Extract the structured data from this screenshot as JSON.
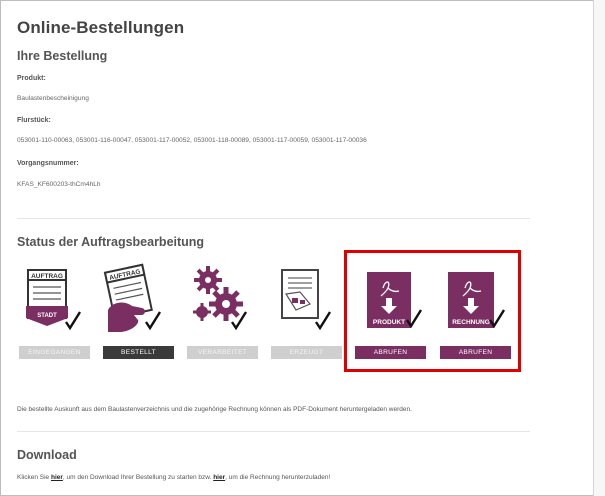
{
  "page": {
    "title": "Online-Bestellungen"
  },
  "order": {
    "heading": "Ihre Bestellung",
    "product_label": "Produkt:",
    "product_value": "Baulastenbescheinigung",
    "parcel_label": "Flurstück:",
    "parcel_value": "053001-110-00063, 053001-116-00047, 053001-117-00052, 053001-118-00089, 053001-117-00059, 053001-117-00036",
    "process_label": "Vorgangsnummer:",
    "process_value": "KFAS_KF600203-thCm4hLh"
  },
  "status": {
    "heading": "Status der Auftragsbearbeitung",
    "steps": [
      {
        "art_top": "AUFTRAG",
        "art_bottom": "STADT",
        "button": "EINGEGANGEN"
      },
      {
        "art_top": "AUFTRAG",
        "button": "BESTELLT"
      },
      {
        "button": "VERARBEITET"
      },
      {
        "button": "ERZEUGT"
      },
      {
        "art_bottom": "PRODUKT",
        "button": "ABRUFEN"
      },
      {
        "art_bottom": "RECHNUNG",
        "button": "ABRUFEN"
      }
    ],
    "colors": {
      "purple": "#7a2e62",
      "highlight": "#e00000"
    }
  },
  "note": "Die bestellte Auskunft aus dem Baulastenverzeichnis und die zugehörige Rechnung können als PDF-Dokument heruntergeladen werden.",
  "download": {
    "heading": "Download",
    "text_1": "Klicken Sie ",
    "link_1": "hier",
    "text_2": ", um den Download Ihrer Bestellung zu starten bzw. ",
    "link_2": "hier",
    "text_3": ", um die Rechnung herunterzuladen!"
  }
}
